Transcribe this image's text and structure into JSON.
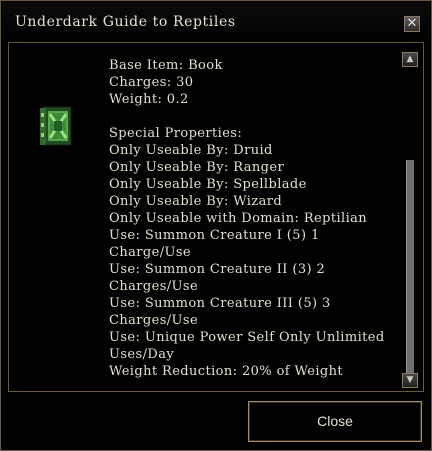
{
  "window": {
    "title": "Underdark Guide to Reptiles"
  },
  "item": {
    "icon": "green-book-icon",
    "base_item": "Base Item: Book",
    "charges": "Charges: 30",
    "weight": "Weight: 0.2",
    "special_header": "Special Properties:",
    "properties": [
      "Only Useable By: Druid",
      "Only Useable By: Ranger",
      "Only Useable By: Spellblade",
      "Only Useable By: Wizard",
      "Only Useable with Domain: Reptilian",
      "Use: Summon Creature I (5) 1",
      "Charge/Use",
      "Use: Summon Creature II (3) 2",
      "Charges/Use",
      "Use: Summon Creature III (5) 3",
      "Charges/Use",
      "Use: Unique Power Self Only Unlimited",
      "Uses/Day",
      "Weight Reduction: 20% of Weight"
    ]
  },
  "buttons": {
    "close_x": "✕",
    "close": "Close",
    "scroll_up": "▲",
    "scroll_down": "▼"
  },
  "colors": {
    "border": "#6b5a3a",
    "text": "#e5dfce",
    "button_border": "#a58a5b"
  }
}
